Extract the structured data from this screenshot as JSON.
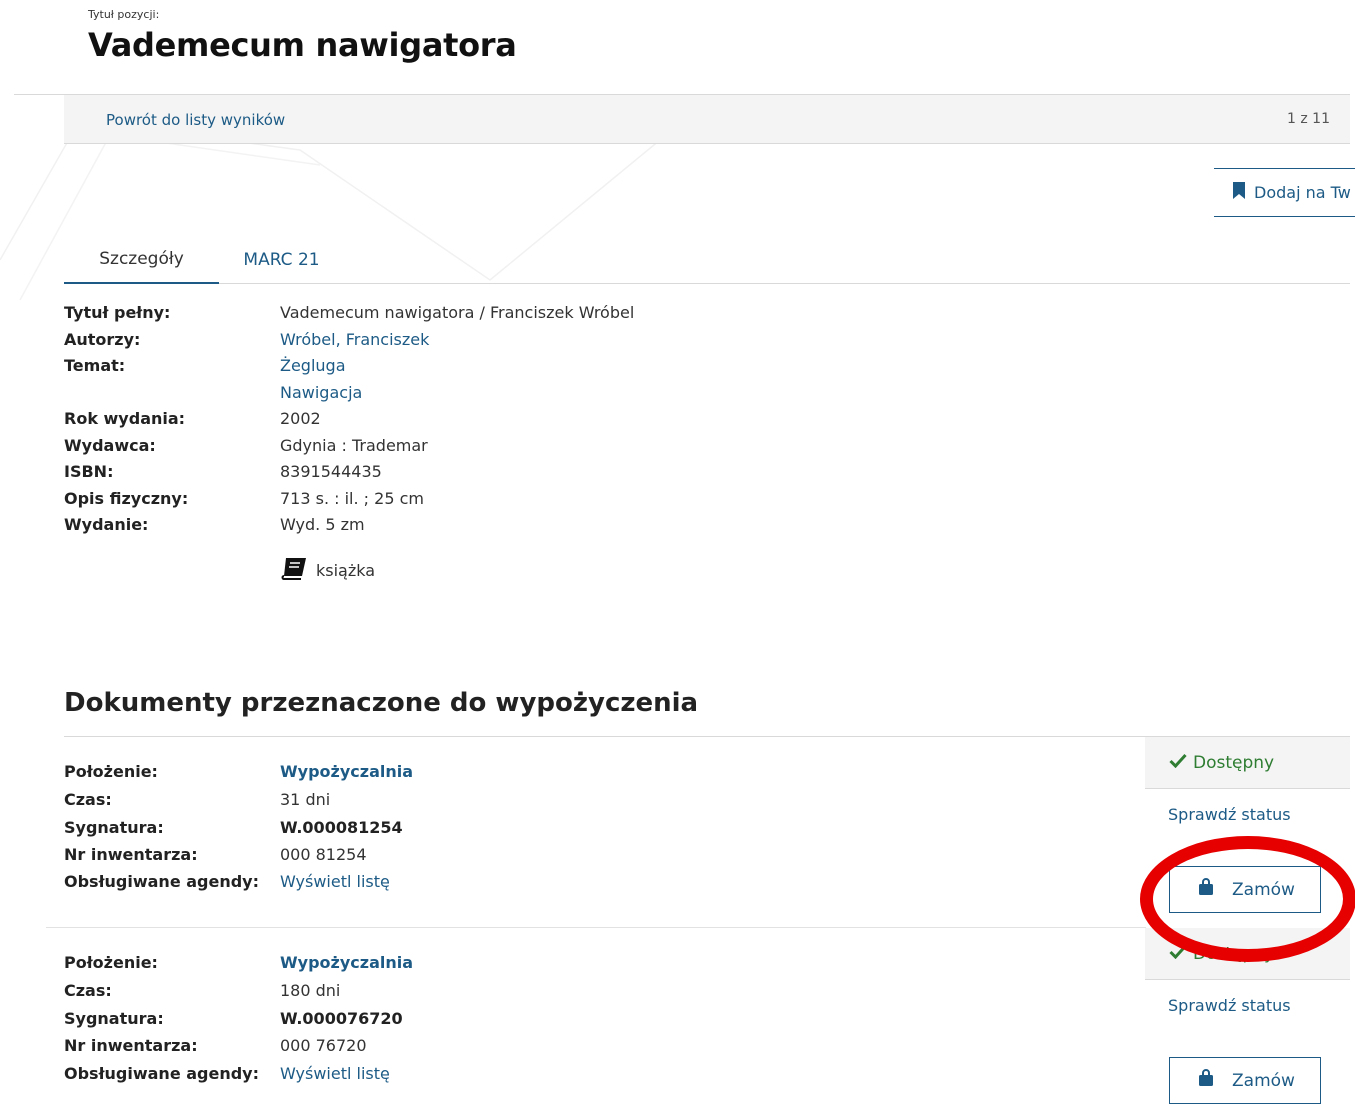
{
  "header": {
    "title_label": "Tytuł pozycji:",
    "title": "Vademecum nawigatora"
  },
  "results_bar": {
    "back_link": "Powrót do listy wyników",
    "pager": "1 z 11"
  },
  "actions": {
    "add_label": "Dodaj na Tw"
  },
  "tabs": [
    {
      "label": "Szczegóły",
      "active": true
    },
    {
      "label": "MARC 21",
      "active": false
    }
  ],
  "details": {
    "full_title_label": "Tytuł pełny:",
    "full_title": "Vademecum nawigatora / Franciszek Wróbel",
    "authors_label": "Autorzy:",
    "author": "Wróbel, Franciszek",
    "subject_label": "Temat:",
    "subjects": [
      "Żegluga",
      "Nawigacja"
    ],
    "year_label": "Rok wydania:",
    "year": "2002",
    "publisher_label": "Wydawca:",
    "publisher": "Gdynia : Trademar",
    "isbn_label": "ISBN:",
    "isbn": "8391544435",
    "physical_label": "Opis fizyczny:",
    "physical": "713 s. : il. ; 25 cm",
    "edition_label": "Wydanie:",
    "edition": "Wyd. 5 zm",
    "doc_type": "książka"
  },
  "section": {
    "title": "Dokumenty przeznaczone do wypożyczenia"
  },
  "labels": {
    "location": "Położenie:",
    "time": "Czas:",
    "signature": "Sygnatura:",
    "inventory": "Nr inwentarza:",
    "agendas": "Obsługiwane agendy:"
  },
  "items": [
    {
      "location": "Wypożyczalnia",
      "time": "31 dni",
      "signature": "W.000081254",
      "inventory": "000 81254",
      "agendas": "Wyświetl listę",
      "status": "Dostępny",
      "check_status": "Sprawdź status",
      "order": "Zamów"
    },
    {
      "location": "Wypożyczalnia",
      "time": "180 dni",
      "signature": "W.000076720",
      "inventory": "000 76720",
      "agendas": "Wyświetl listę",
      "status": "Dostępny",
      "check_status": "Sprawdź status",
      "order": "Zamów"
    }
  ],
  "colors": {
    "link": "#1d5b86",
    "available": "#2e7d32",
    "highlight": "#e60000"
  },
  "icons": {
    "bookmark": "bookmark-icon",
    "book": "book-icon",
    "check": "check-icon",
    "bag": "shopping-bag-icon"
  }
}
